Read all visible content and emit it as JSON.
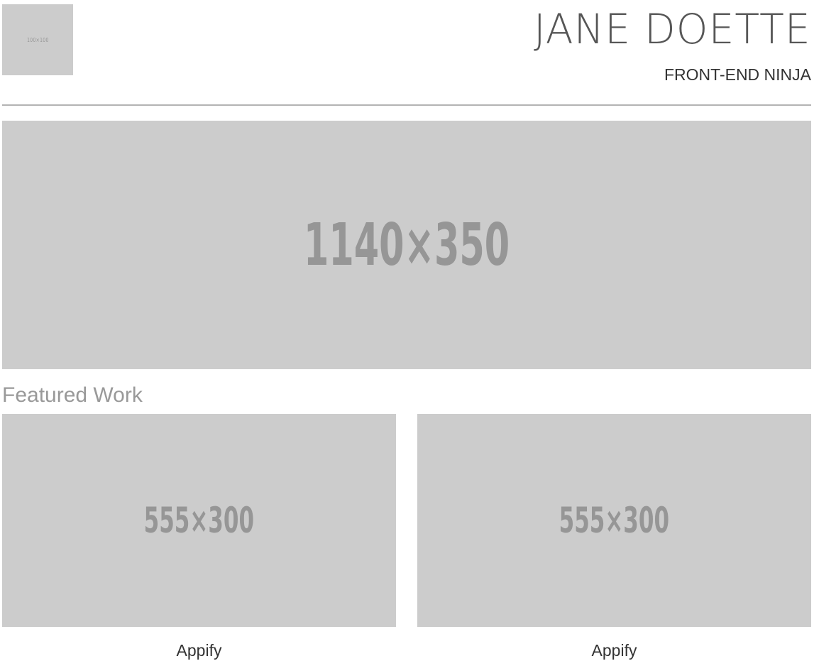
{
  "header": {
    "logo_text": "100×100",
    "name": "JANE DOETTE",
    "tagline": "FRONT-END NINJA"
  },
  "hero": {
    "placeholder_text": "1140×350"
  },
  "featured": {
    "title": "Featured Work",
    "items": [
      {
        "placeholder_text": "555×300",
        "caption": "Appify"
      },
      {
        "placeholder_text": "555×300",
        "caption": "Appify"
      }
    ]
  },
  "colors": {
    "placeholder_bg": "#cccccc",
    "placeholder_text": "#969696",
    "section_title": "#999999",
    "divider": "#b3b3b3",
    "text": "#333333"
  }
}
